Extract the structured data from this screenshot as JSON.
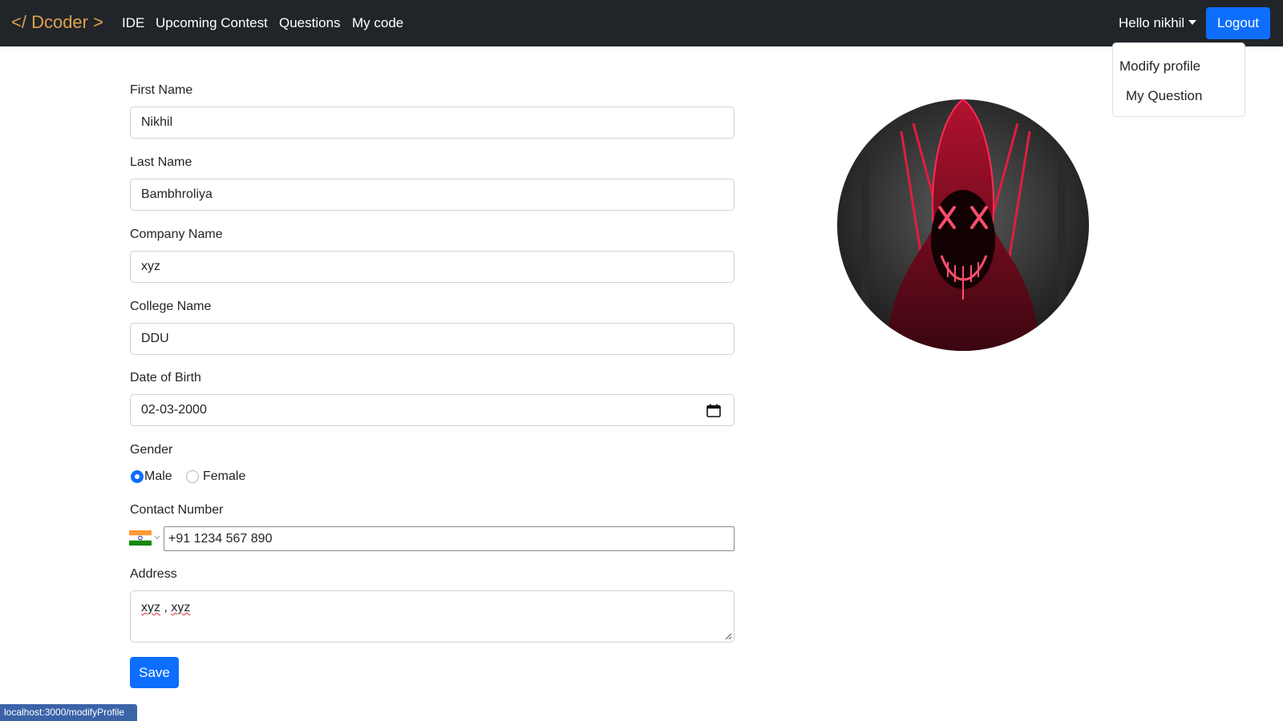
{
  "navbar": {
    "brand": "</ Dcoder >",
    "links": [
      "IDE",
      "Upcoming Contest",
      "Questions",
      "My code"
    ],
    "greeting": "Hello nikhil",
    "logout_label": "Logout"
  },
  "dropdown": {
    "items": [
      "Modify profile",
      "My Question"
    ]
  },
  "form": {
    "first_name": {
      "label": "First Name",
      "value": "Nikhil"
    },
    "last_name": {
      "label": "Last Name",
      "value": "Bambhroliya"
    },
    "company_name": {
      "label": "Company Name",
      "value": "xyz"
    },
    "college_name": {
      "label": "College Name",
      "value": "DDU"
    },
    "dob": {
      "label": "Date of Birth",
      "value": "02-03-2000"
    },
    "gender": {
      "label": "Gender",
      "options": [
        "Male",
        "Female"
      ],
      "selected": "Male"
    },
    "contact": {
      "label": "Contact Number",
      "value": "+91 1234 567 890",
      "country_flag": "india-flag-icon"
    },
    "address": {
      "label": "Address",
      "words": [
        "xyz",
        " , ",
        "xyz"
      ]
    },
    "save_label": "Save"
  },
  "status_bar": {
    "url": "localhost:3000/modifyProfile"
  },
  "colors": {
    "navbar_bg": "#212529",
    "brand": "#e0a14d",
    "primary": "#0d6efd",
    "avatar_glow": "#ff2a55"
  }
}
